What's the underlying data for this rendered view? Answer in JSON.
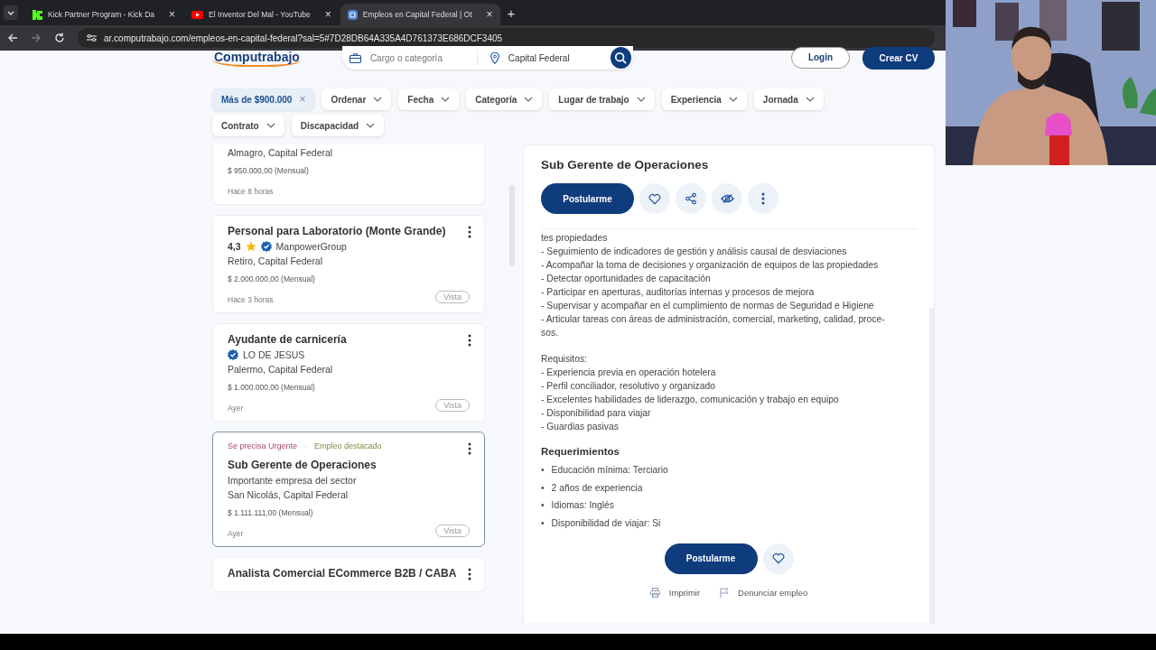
{
  "browser": {
    "tabs": [
      {
        "title": "Kick Partner Program - Kick Da",
        "kind": "kick",
        "close": "×",
        "selected": false
      },
      {
        "title": "El Inventor Del Mal - YouTube",
        "kind": "youtube",
        "close": "×",
        "selected": false
      },
      {
        "title": "Empleos en Capital Federal | Ot",
        "kind": "site",
        "close": "×",
        "selected": true
      }
    ],
    "new_tab": "+",
    "url": "ar.computrabajo.com/empleos-en-capital-federal?sal=5#7D28DB64A335A4D761373E686DCF3405"
  },
  "header": {
    "logo": "Computrabajo",
    "search_placeholder": "Cargo o categoría",
    "location": "Capital Federal",
    "login": "Login",
    "create_cv": "Crear CV"
  },
  "filters": [
    {
      "label": "Más de $900.000",
      "active": true,
      "remove": "×"
    },
    {
      "label": "Ordenar",
      "active": false
    },
    {
      "label": "Fecha",
      "active": false
    },
    {
      "label": "Categoría",
      "active": false
    },
    {
      "label": "Lugar de trabajo",
      "active": false
    },
    {
      "label": "Experiencia",
      "active": false
    },
    {
      "label": "Jornada",
      "active": false
    },
    {
      "label": "Contrato",
      "active": false
    },
    {
      "label": "Discapacidad",
      "active": false
    }
  ],
  "jobs": [
    {
      "location": "Almagro, Capital Federal",
      "salary": "$ 950.000,00 (Mensual)",
      "posted": "Hace 8 horas",
      "selected": false
    },
    {
      "title": "Personal para Laboratorio (Monte Grande)",
      "rating": "4,3",
      "company": "ManpowerGroup",
      "verified": true,
      "location": "Retiro, Capital Federal",
      "salary": "$ 2.000.000,00 (Mensual)",
      "posted": "Hace 3 horas",
      "action": "Vista",
      "selected": false
    },
    {
      "title": "Ayudante de carnicería",
      "company": "LO DE JESUS",
      "verified": true,
      "location": "Palermo, Capital Federal",
      "salary": "$ 1.000.000,00 (Mensual)",
      "posted": "Ayer",
      "action": "Vista",
      "selected": false
    },
    {
      "urgent": "Se precisa Urgente",
      "separator": "·",
      "featured": "Empleo destacado",
      "title": "Sub Gerente de Operaciones",
      "company": "Importante empresa del sector",
      "verified": false,
      "location": "San Nicolás, Capital Federal",
      "salary": "$ 1.111.111,00 (Mensual)",
      "posted": "Ayer",
      "action": "Vista",
      "selected": true
    },
    {
      "title": "Analista Comercial ECommerce B2B / CABA",
      "selected": false
    }
  ],
  "detail": {
    "title": "Sub Gerente de Operaciones",
    "apply": "Postularme",
    "description": [
      {
        "lines": [
          "tes propiedades",
          "- Seguimiento de indicadores de gestión y análisis causal de desviaciones",
          "- Acompañar la toma de decisiones y organización de equipos de las propiedades",
          "- Detectar oportunidades de capacitación",
          "- Participar en aperturas, auditorías internas y procesos de mejora",
          "- Supervisar y acompañar en el cumplimiento de normas de Seguridad e Higiene",
          "- Articular tareas con áreas de administración, comercial, marketing, calidad, proce-",
          "sos."
        ]
      },
      {
        "lines": [
          "Requisitos:",
          "- Experiencia previa en operación hotelera",
          "- Perfil conciliador, resolutivo y organizado",
          "- Excelentes habilidades de liderazgo, comunicación y trabajo en equipo",
          "- Disponibilidad para viajar",
          "- Guardias pasivas"
        ]
      }
    ],
    "requirements_title": "Requerimientos",
    "requirements": [
      {
        "marker": "•",
        "text": "Educación mínima: Terciario"
      },
      {
        "marker": "•",
        "text": "2 años de experiencia"
      },
      {
        "marker": "•",
        "text": "Idiomas: Inglés"
      },
      {
        "marker": "•",
        "text": "Disponibilidad de viajar: Si"
      }
    ],
    "apply_bottom": "Postularme",
    "print": "Imprimir",
    "report": "Denunciar empleo"
  }
}
